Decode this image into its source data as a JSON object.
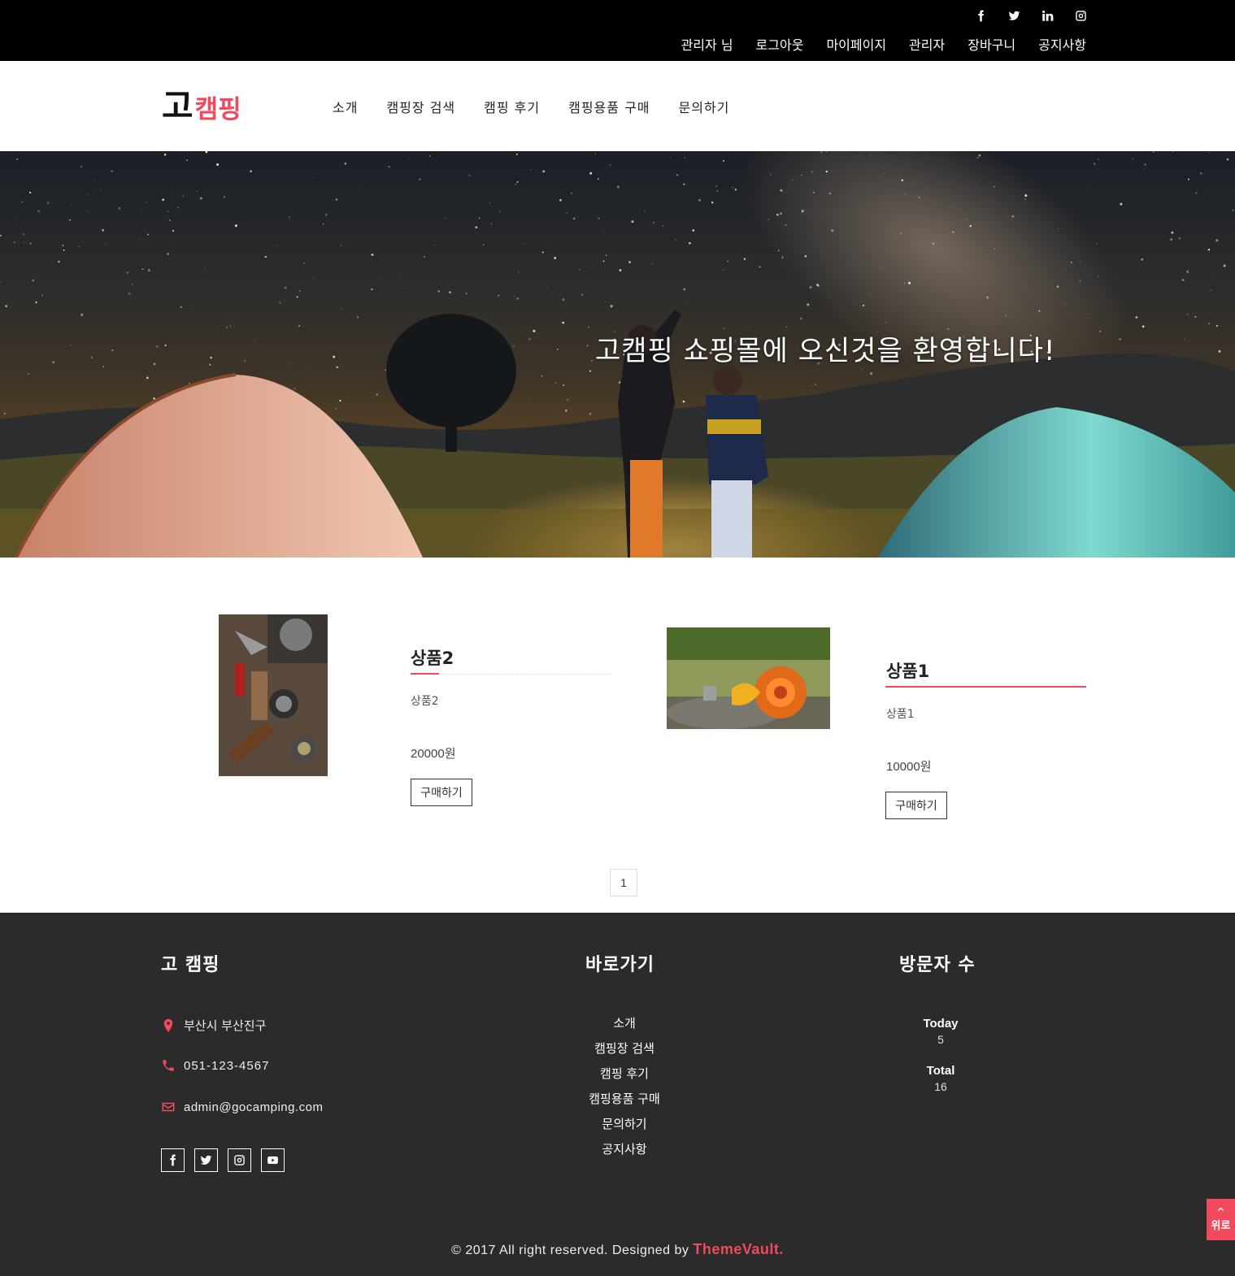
{
  "topbar": {
    "social": [
      "facebook-icon",
      "twitter-icon",
      "linkedin-icon",
      "instagram-icon"
    ],
    "nav": [
      "관리자 님",
      "로그아웃",
      "마이페이지",
      "관리자",
      "장바구니",
      "공지사항"
    ]
  },
  "header": {
    "logo_main": "고",
    "logo_accent": "캠핑",
    "nav": [
      "소개",
      "캠핑장 검색",
      "캠핑 후기",
      "캠핑용품 구매",
      "문의하기"
    ]
  },
  "hero": {
    "title": "고캠핑 쇼핑몰에 오신것을 환영합니다!"
  },
  "products": [
    {
      "title": "상품2",
      "desc": "상품2",
      "price": "20000원",
      "button": "구매하기",
      "image": "camping-tools-image"
    },
    {
      "title": "상품1",
      "desc": "상품1",
      "price": "10000원",
      "button": "구매하기",
      "image": "sleeping-bag-image"
    }
  ],
  "pagination": {
    "current": "1"
  },
  "footer": {
    "brand_heading": "고 캠핑",
    "address": "부산시 부산진구",
    "phone": "051-123-4567",
    "email": "admin@gocamping.com",
    "social": [
      "facebook-icon",
      "twitter-icon",
      "instagram-icon",
      "youtube-icon"
    ],
    "links_heading": "바로가기",
    "links": [
      "소개",
      "캠핑장 검색",
      "캠핑 후기",
      "캠핑용품 구매",
      "문의하기",
      "공지사항"
    ],
    "visitors_heading": "방문자 수",
    "today_label": "Today",
    "today_value": "5",
    "total_label": "Total",
    "total_value": "16",
    "copyright": "© 2017 All right reserved. Designed by",
    "designer": "ThemeVault."
  },
  "to_top": {
    "label": "위로"
  },
  "colors": {
    "accent": "#f04a5c",
    "topbar": "#000000",
    "footer": "#2b2b2b"
  }
}
